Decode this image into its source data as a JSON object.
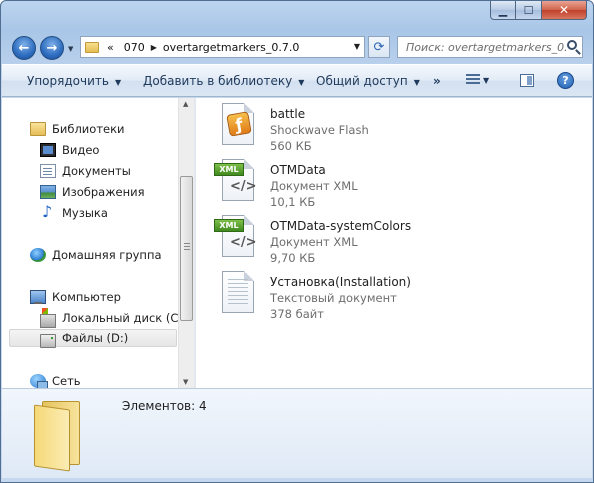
{
  "address": {
    "overflow": "«",
    "crumbs": [
      "070",
      "overtargetmarkers_0.7.0"
    ]
  },
  "search": {
    "placeholder": "Поиск: overtargetmarkers_0..."
  },
  "toolbar": {
    "organize": "Упорядочить",
    "add_library": "Добавить в библиотеку",
    "share": "Общий доступ",
    "more": "»"
  },
  "nav": {
    "libraries": "Библиотеки",
    "video": "Видео",
    "documents": "Документы",
    "images": "Изображения",
    "music": "Музыка",
    "homegroup": "Домашняя группа",
    "computer": "Компьютер",
    "drive_c": "Локальный диск (C:)",
    "drive_d": "Файлы (D:)",
    "network": "Сеть"
  },
  "files": [
    {
      "name": "battle",
      "type": "Shockwave Flash",
      "size": "560 КБ",
      "icon": "flash-icon"
    },
    {
      "name": "OTMData",
      "type": "Документ XML",
      "size": "10,1 КБ",
      "icon": "xml-icon"
    },
    {
      "name": "OTMData-systemColors",
      "type": "Документ XML",
      "size": "9,70 КБ",
      "icon": "xml-icon"
    },
    {
      "name": "Установка(Installation)",
      "type": "Текстовый документ",
      "size": "378 байт",
      "icon": "text-document-icon"
    }
  ],
  "xml_badge": "XML",
  "details": {
    "count": "Элементов: 4"
  }
}
